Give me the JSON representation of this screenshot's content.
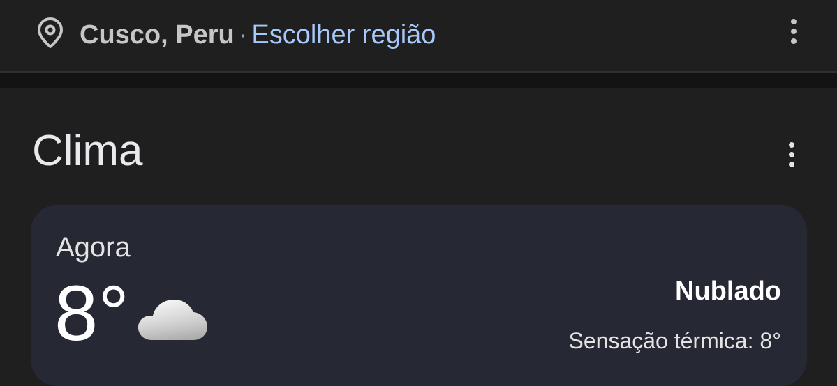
{
  "location": {
    "city": "Cusco, Peru",
    "separator": "·",
    "change_region_label": "Escolher região",
    "pin_icon": "location-pin-icon",
    "menu_icon": "more-vert-icon"
  },
  "weather": {
    "title": "Clima",
    "menu_icon": "more-vert-icon",
    "now_label": "Agora",
    "temperature": "8°",
    "condition_icon": "cloud-icon",
    "condition": "Nublado",
    "feels_like": "Sensação térmica: 8°"
  },
  "colors": {
    "background": "#1f1f1f",
    "card": "#262833",
    "link": "#a8c7fa",
    "text": "#e3e3e3"
  }
}
